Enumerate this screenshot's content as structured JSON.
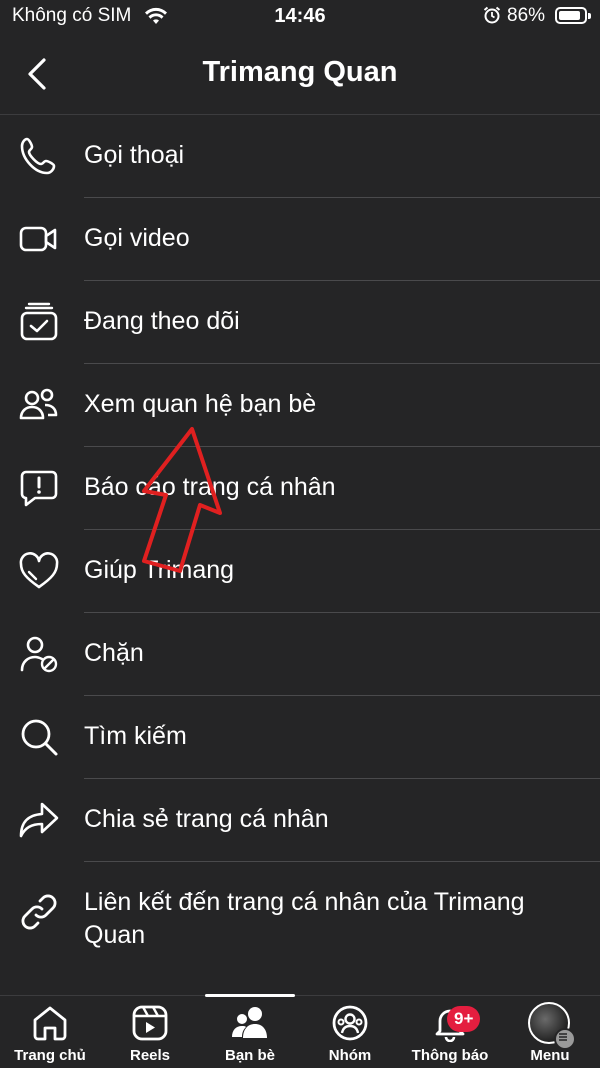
{
  "status_bar": {
    "carrier": "Không có SIM",
    "time": "14:46",
    "battery": "86%",
    "icons": [
      "wifi-icon",
      "alarm-icon",
      "battery-icon"
    ]
  },
  "header": {
    "title": "Trimang Quan",
    "back_icon": "chevron-left-icon"
  },
  "menu": {
    "items": [
      {
        "label": "Gọi thoại",
        "icon": "phone-icon"
      },
      {
        "label": "Gọi video",
        "icon": "video-camera-icon"
      },
      {
        "label": "Đang theo dõi",
        "icon": "following-inbox-icon"
      },
      {
        "label": "Xem quan hệ bạn bè",
        "icon": "friends-icon"
      },
      {
        "label": "Báo cáo trang cá nhân",
        "icon": "report-icon"
      },
      {
        "label": "Giúp Trimang",
        "icon": "heart-icon"
      },
      {
        "label": "Chặn",
        "icon": "block-user-icon"
      },
      {
        "label": "Tìm kiếm",
        "icon": "search-icon"
      },
      {
        "label": "Chia sẻ trang cá nhân",
        "icon": "share-icon"
      },
      {
        "label": "Liên kết đến trang cá nhân của Trimang Quan",
        "icon": "link-icon"
      }
    ]
  },
  "tab_bar": {
    "tabs": [
      {
        "label": "Trang chủ",
        "icon": "home-icon"
      },
      {
        "label": "Reels",
        "icon": "reels-icon"
      },
      {
        "label": "Bạn bè",
        "icon": "friends-tab-icon",
        "active": true
      },
      {
        "label": "Nhóm",
        "icon": "groups-icon"
      },
      {
        "label": "Thông báo",
        "icon": "bell-icon",
        "badge": "9+"
      },
      {
        "label": "Menu",
        "icon": "avatar-icon"
      }
    ]
  },
  "colors": {
    "background": "#252526",
    "text": "#ffffff",
    "divider": "#4a4a4c",
    "badge": "#e41e3f",
    "annotation": "#e02020"
  }
}
